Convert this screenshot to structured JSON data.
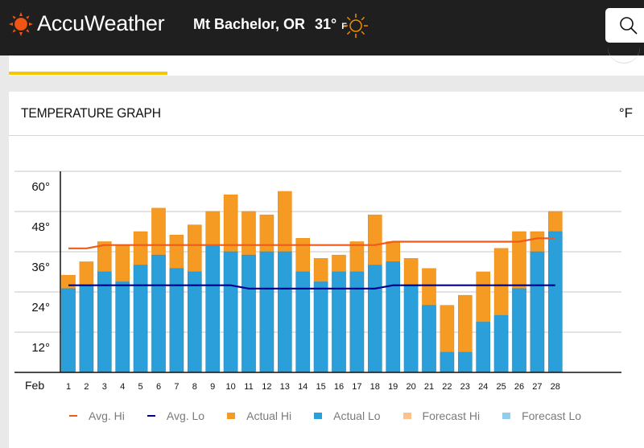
{
  "header": {
    "brand": "AccuWeather",
    "location": "Mt Bachelor, OR",
    "current_temp": "31°",
    "temp_unit": "F",
    "weather_icon": "sunny-icon",
    "search_icon": "search-icon"
  },
  "colors": {
    "brand_orange": "#f05514",
    "topbar": "#1f1f1f",
    "nav_active": "#f6c700",
    "avg_hi": "#f05a1a",
    "avg_lo": "#00008b",
    "actual_hi": "#f59a23",
    "actual_lo": "#2b9fd9",
    "forecast_hi": "#fcc18c",
    "forecast_lo": "#93cdee"
  },
  "card": {
    "title": "TEMPERATURE GRAPH",
    "unit_toggle": "°F"
  },
  "chart_data": {
    "type": "bar",
    "title": "TEMPERATURE GRAPH",
    "xlabel": "Feb",
    "ylabel": "",
    "ylim": [
      0,
      60
    ],
    "yticks": [
      12,
      24,
      36,
      48,
      60
    ],
    "ytick_labels": [
      "12°",
      "24°",
      "36°",
      "48°",
      "60°"
    ],
    "grid": true,
    "legend_position": "bottom",
    "categories": [
      "1",
      "2",
      "3",
      "4",
      "5",
      "6",
      "7",
      "8",
      "9",
      "10",
      "11",
      "12",
      "13",
      "14",
      "15",
      "16",
      "17",
      "18",
      "19",
      "20",
      "21",
      "22",
      "23",
      "24",
      "25",
      "26",
      "27",
      "28"
    ],
    "series": [
      {
        "name": "Actual Hi",
        "type": "bar",
        "values": [
          29,
          33,
          39,
          38,
          42,
          49,
          41,
          44,
          48,
          53,
          48,
          47,
          54,
          40,
          34,
          35,
          39,
          47,
          39,
          34,
          31,
          20,
          23,
          30,
          37,
          42,
          42,
          48
        ]
      },
      {
        "name": "Actual Lo",
        "type": "bar",
        "values": [
          25,
          26,
          30,
          27,
          32,
          35,
          31,
          30,
          38,
          36,
          35,
          36,
          36,
          30,
          27,
          30,
          30,
          32,
          33,
          26,
          20,
          6,
          6,
          15,
          17,
          25,
          36,
          42
        ]
      },
      {
        "name": "Avg. Hi",
        "type": "line",
        "values": [
          37,
          37,
          38,
          38,
          38,
          38,
          38,
          38,
          38,
          38,
          38,
          38,
          38,
          38,
          38,
          38,
          38,
          38,
          39,
          39,
          39,
          39,
          39,
          39,
          39,
          39,
          40,
          40
        ]
      },
      {
        "name": "Avg. Lo",
        "type": "line",
        "values": [
          26,
          26,
          26,
          26,
          26,
          26,
          26,
          26,
          26,
          26,
          25,
          25,
          25,
          25,
          25,
          25,
          25,
          25,
          26,
          26,
          26,
          26,
          26,
          26,
          26,
          26,
          26,
          26
        ]
      },
      {
        "name": "Forecast Hi",
        "type": "bar",
        "values": []
      },
      {
        "name": "Forecast Lo",
        "type": "bar",
        "values": []
      }
    ]
  },
  "legend": [
    {
      "label": "Avg. Hi",
      "kind": "line",
      "color": "#f05a1a"
    },
    {
      "label": "Avg. Lo",
      "kind": "line",
      "color": "#00008b"
    },
    {
      "label": "Actual Hi",
      "kind": "box",
      "color": "#f59a23"
    },
    {
      "label": "Actual Lo",
      "kind": "box",
      "color": "#2b9fd9"
    },
    {
      "label": "Forecast Hi",
      "kind": "box",
      "color": "#fcc18c"
    },
    {
      "label": "Forecast Lo",
      "kind": "box",
      "color": "#93cdee"
    }
  ]
}
